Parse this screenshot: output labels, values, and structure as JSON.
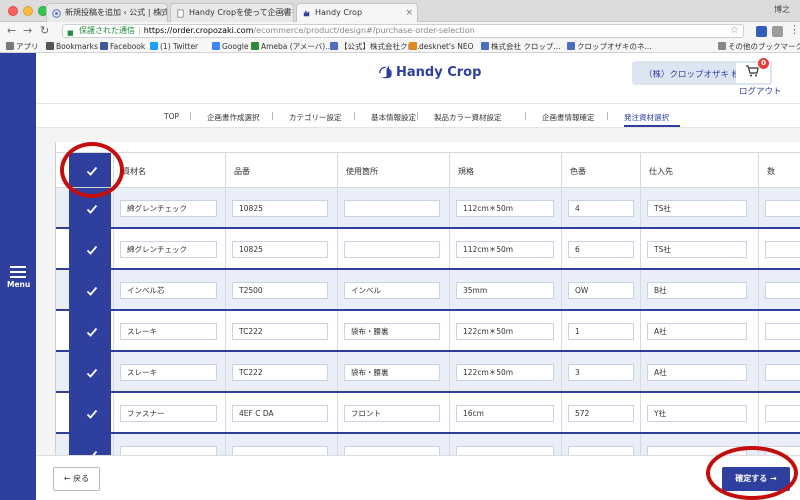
{
  "browser": {
    "tabs": [
      {
        "label": "新規投稿を追加 ‹ 公式 | 株式会社"
      },
      {
        "label": "Handy Cropを使って企画書を作"
      },
      {
        "label": "Handy Crop"
      }
    ],
    "close_glyph": "×",
    "profile": "博之",
    "url": {
      "secure_label": "保護された通信",
      "host": "https://order.cropozaki.com",
      "path": "/ecommerce/product/design#/purchase-order-selection"
    },
    "bookmarks": [
      {
        "label": "アプリ",
        "icon": "apps-icon",
        "color": "#777777"
      },
      {
        "label": "Bookmarks",
        "icon": "star-icon",
        "color": "#555555"
      },
      {
        "label": "Facebook",
        "icon": "facebook-icon",
        "color": "#3b5998"
      },
      {
        "label": "(1) Twitter",
        "icon": "twitter-icon",
        "color": "#1da1f2"
      },
      {
        "label": "Google",
        "icon": "google-icon",
        "color": "#4285f4"
      },
      {
        "label": "Ameba (アメーバ)...",
        "icon": "ameba-icon",
        "color": "#2d8c3c"
      },
      {
        "label": "【公式】株式会社クロ...",
        "icon": "globe-icon",
        "color": "#4a6fc2"
      },
      {
        "label": "desknet's NEO",
        "icon": "desknets-icon",
        "color": "#e08a1e"
      },
      {
        "label": "株式会社 クロップ...",
        "icon": "globe-icon",
        "color": "#4a6fc2"
      },
      {
        "label": "クロップオザキのネ...",
        "icon": "globe-icon",
        "color": "#4a6fc2"
      },
      {
        "label": "その他のブックマーク",
        "icon": "folder-icon",
        "color": "#888888"
      }
    ]
  },
  "app": {
    "menu_label": "Menu",
    "logo_text": "Handy Crop",
    "account_name": "（株）クロップオザキ 様",
    "cart_count": "0",
    "logout_label": "ログアウト",
    "steps": [
      {
        "label": "TOP"
      },
      {
        "label": "企画書作成選択"
      },
      {
        "label": "カテゴリー設定"
      },
      {
        "label": "基本情報設定"
      },
      {
        "label": "製品カラー資材設定"
      },
      {
        "label": "企画書情報確定"
      },
      {
        "label": "発注資材選択"
      }
    ],
    "active_step_index": 6,
    "step_separator": "|",
    "columns": [
      "資材名",
      "品番",
      "使用箇所",
      "規格",
      "色番",
      "仕入先",
      "数"
    ],
    "rows": [
      {
        "checked": true,
        "material": "綿グレンチェック",
        "part_no": "10825",
        "location": "",
        "spec": "112cm＊50m",
        "color_no": "4",
        "supplier": "TS社"
      },
      {
        "checked": true,
        "material": "綿グレンチェック",
        "part_no": "10825",
        "location": "",
        "spec": "112cm＊50m",
        "color_no": "6",
        "supplier": "TS社"
      },
      {
        "checked": true,
        "material": "インベル芯",
        "part_no": "T2500",
        "location": "インベル",
        "spec": "35mm",
        "color_no": "OW",
        "supplier": "B社"
      },
      {
        "checked": true,
        "material": "スレーキ",
        "part_no": "TC222",
        "location": "袋布・腰裏",
        "spec": "122cm＊50m",
        "color_no": "1",
        "supplier": "A社"
      },
      {
        "checked": true,
        "material": "スレーキ",
        "part_no": "TC222",
        "location": "袋布・腰裏",
        "spec": "122cm＊50m",
        "color_no": "3",
        "supplier": "A社"
      },
      {
        "checked": true,
        "material": "ファスナー",
        "part_no": "4EF C DA",
        "location": "フロント",
        "spec": "16cm",
        "color_no": "572",
        "supplier": "Y社"
      },
      {
        "checked": true,
        "material": "",
        "part_no": "",
        "location": "",
        "spec": "",
        "color_no": "",
        "supplier": ""
      }
    ],
    "back_label": "← 戻る",
    "confirm_label": "確定する →",
    "colors": {
      "primary": "#2f3f9e",
      "annotation": "#c40d0d",
      "row_tint": "#e9eef8"
    }
  }
}
